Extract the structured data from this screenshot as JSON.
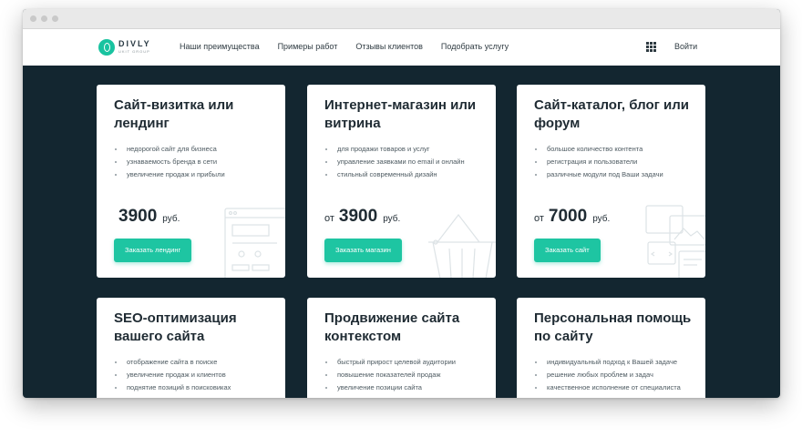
{
  "header": {
    "logo_name": "DIVLY",
    "logo_sub": "UKIT GROUP",
    "nav": [
      "Наши преимущества",
      "Примеры работ",
      "Отзывы клиентов",
      "Подобрать услугу"
    ],
    "login_label": "Войти"
  },
  "cards": [
    {
      "title": "Сайт-визитка или лендинг",
      "features": [
        "недорогой сайт для бизнеса",
        "узнаваемость бренда в сети",
        "увеличение продаж и прибыли"
      ],
      "price_prefix": "",
      "price": "3900",
      "currency": "руб.",
      "button": "Заказать лендинг"
    },
    {
      "title": "Интернет-магазин или витрина",
      "features": [
        "для продажи товаров и услуг",
        "управление заявками по email и онлайн",
        "стильный современный дизайн"
      ],
      "price_prefix": "от",
      "price": "3900",
      "currency": "руб.",
      "button": "Заказать магазин"
    },
    {
      "title": "Сайт-каталог, блог или форум",
      "features": [
        "большое количество контента",
        "регистрация и пользователи",
        "различные модули под Ваши задачи"
      ],
      "price_prefix": "от",
      "price": "7000",
      "currency": "руб.",
      "button": "Заказать сайт"
    },
    {
      "title": "SEO-оптимизация вашего сайта",
      "features": [
        "отображение сайта в поиске",
        "увеличение продаж и клиентов",
        "поднятие позиций в поисковиках"
      ]
    },
    {
      "title": "Продвижение сайта контекстом",
      "features": [
        "быстрый прирост целевой аудитории",
        "повышение показателей продаж",
        "увеличение позиции сайта"
      ]
    },
    {
      "title": "Персональная помощь по сайту",
      "features": [
        "индивидуальный подход к Вашей задаче",
        "решение любых проблем и задач",
        "качественное исполнение от специалиста"
      ]
    }
  ],
  "colors": {
    "accent": "#1ec5a2",
    "background": "#132630"
  }
}
